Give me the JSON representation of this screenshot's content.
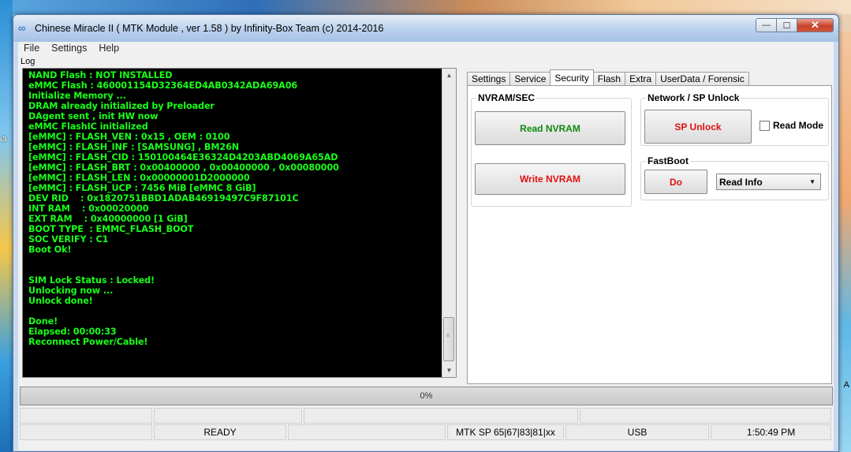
{
  "window": {
    "title": "Chinese Miracle II ( MTK Module , ver 1.58 ) by Infinity-Box Team (c) 2014-2016",
    "min_glyph": "—",
    "max_glyph": "☐",
    "close_glyph": "✕"
  },
  "menu": [
    "File",
    "Settings",
    "Help"
  ],
  "log": {
    "label": "Log",
    "lines": [
      "NAND Flash : NOT INSTALLED",
      "eMMC Flash : 460001154D32364ED4AB0342ADA69A06",
      "Initialize Memory ...",
      "DRAM already initialized by Preloader",
      "DAgent sent , init HW now",
      "eMMC FlashIC initialized",
      "[eMMC] : FLASH_VEN : 0x15 , OEM : 0100",
      "[eMMC] : FLASH_INF : [SAMSUNG] , BM26N",
      "[eMMC] : FLASH_CID : 150100464E36324D4203ABD4069A65AD",
      "[eMMC] : FLASH_BRT : 0x00400000 , 0x00400000 , 0x00080000",
      "[eMMC] : FLASH_LEN : 0x00000001D2000000",
      "[eMMC] : FLASH_UCP : 7456 MiB [eMMC 8 GiB]",
      "DEV RID    : 0x1820751BBD1ADAB46919497C9F87101C",
      "INT RAM    : 0x00020000",
      "EXT RAM    : 0x40000000 [1 GiB]",
      "BOOT TYPE  : EMMC_FLASH_BOOT",
      "SOC VERIFY : C1",
      "Boot Ok!",
      "",
      "",
      "SIM Lock Status : Locked!",
      "Unlocking now ...",
      "Unlock done!",
      "",
      "Done!",
      "Elapsed: 00:00:33",
      "Reconnect Power/Cable!"
    ]
  },
  "tabs": [
    "Settings",
    "Service",
    "Security",
    "Flash",
    "Extra",
    "UserData / Forensic"
  ],
  "active_tab": "Security",
  "security": {
    "nvram_group": "NVRAM/SEC",
    "read_nvram": "Read NVRAM",
    "write_nvram": "Write NVRAM",
    "network_group": "Network / SP Unlock",
    "sp_unlock": "SP Unlock",
    "read_mode": "Read Mode",
    "fastboot_group": "FastBoot",
    "do": "Do",
    "fastboot_option": "Read Info"
  },
  "progress": {
    "text": "0%",
    "value": 0
  },
  "status": {
    "row1": [
      "",
      "",
      "",
      ""
    ],
    "row2": [
      "",
      "READY",
      "",
      "MTK SP 65|67|83|81|xx",
      "USB",
      "1:50:49 PM"
    ]
  },
  "colors": {
    "log_bg": "#000000",
    "log_text": "#18ff18",
    "green_btn": "#108a10",
    "red_btn": "#e01010"
  },
  "desktop": {
    "left_char": "ia",
    "right_char": "A"
  }
}
